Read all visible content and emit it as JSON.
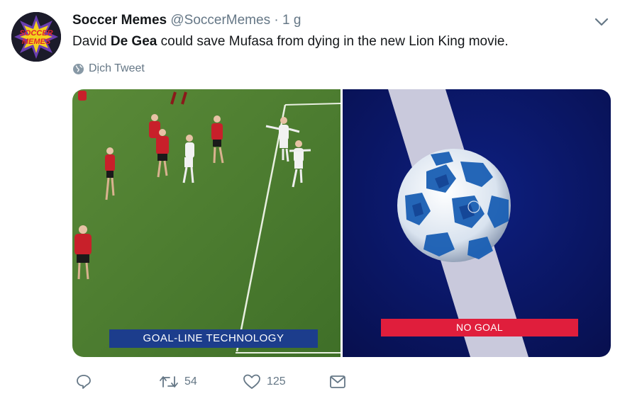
{
  "tweet": {
    "author_name": "Soccer Memes",
    "author_handle": "@SoccerMemes",
    "separator": "·",
    "time": "1 g",
    "text_before": "David ",
    "text_bold": "De Gea",
    "text_after": " could save Mufasa from dying in the new Lion King movie.",
    "translate_label": "Dịch Tweet",
    "avatar_text": "SOCCER MEMES"
  },
  "media": {
    "left_caption": "GOAL-LINE TECHNOLOGY",
    "right_caption": "NO GOAL",
    "colors": {
      "pitch": "#4a7a2e",
      "kit_red": "#c8202a",
      "away_kit": "#f2f2f2",
      "backdrop": "#0a1760",
      "line": "#c9c9dc",
      "ball_blue": "#1a5fb4"
    }
  },
  "actions": {
    "reply_icon": "reply-icon",
    "retweet_count": "54",
    "like_count": "125",
    "dm_icon": "envelope-icon"
  }
}
